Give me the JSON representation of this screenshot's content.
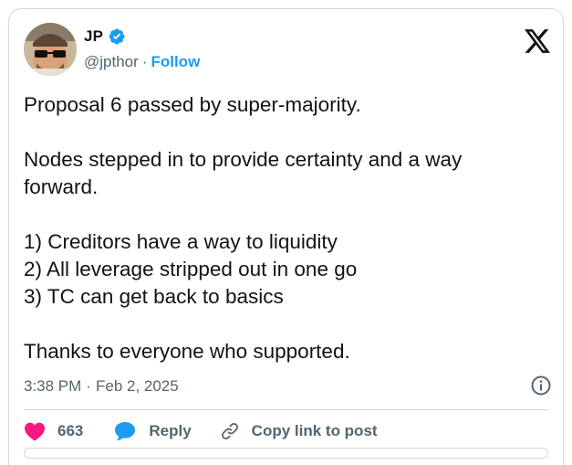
{
  "author": {
    "name": "JP",
    "handle": "@jpthor",
    "separator": "·",
    "follow_label": "Follow"
  },
  "tweet": {
    "paragraphs": [
      [
        "Proposal 6 passed by super-majority."
      ],
      [
        "Nodes stepped in to provide certainty and a way",
        "forward."
      ],
      [
        "1) Creditors have a way to liquidity",
        "2) All leverage stripped out in one go",
        "3) TC can get back to basics"
      ],
      [
        "Thanks to everyone who supported."
      ]
    ]
  },
  "meta": {
    "time": "3:38 PM",
    "separator": "·",
    "date": "Feb 2, 2025"
  },
  "actions": {
    "like_count": "663",
    "reply_label": "Reply",
    "copy_label": "Copy link to post"
  },
  "colors": {
    "accent": "#1d9bf0",
    "like": "#f91880",
    "text": "#0f1419",
    "muted": "#536471",
    "border": "#cfd9de"
  },
  "icons": [
    "verified-badge-icon",
    "x-logo-icon",
    "info-icon",
    "heart-icon",
    "reply-bubble-icon",
    "link-icon"
  ]
}
